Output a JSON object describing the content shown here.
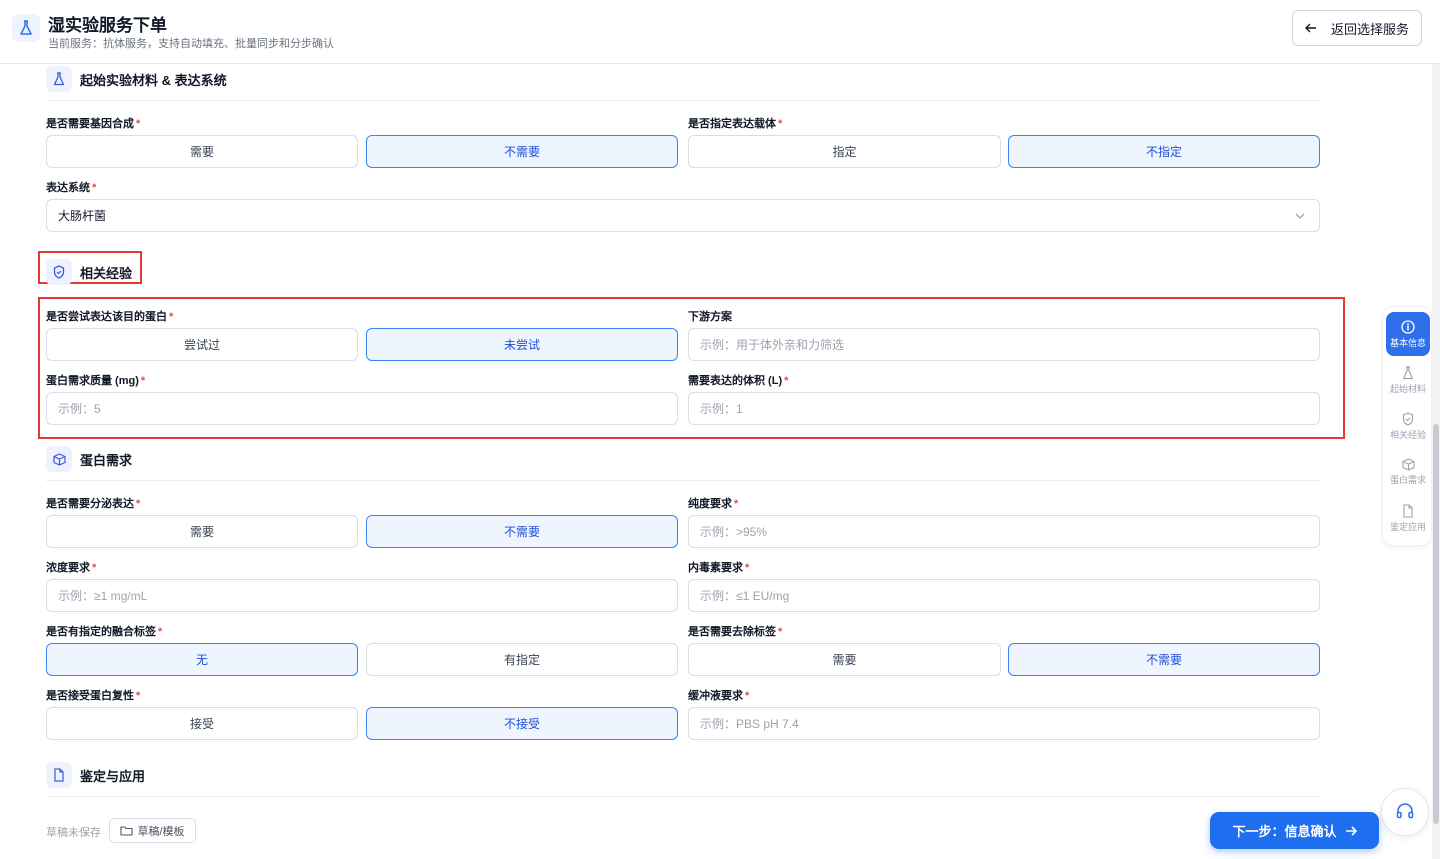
{
  "header": {
    "title": "湿实验服务下单",
    "subtitle": "当前服务：抗体服务，支持自动填充、批量同步和分步确认",
    "back_label": "返回选择服务"
  },
  "sections": {
    "material": {
      "title": "起始实验材料 & 表达系统",
      "gene_synthesis": {
        "label": "是否需要基因合成",
        "options": [
          "需要",
          "不需要"
        ],
        "selected": "不需要"
      },
      "vector": {
        "label": "是否指定表达载体",
        "options": [
          "指定",
          "不指定"
        ],
        "selected": "不指定"
      },
      "expression_system": {
        "label": "表达系统",
        "value": "大肠杆菌"
      }
    },
    "experience": {
      "title": "相关经验",
      "tried": {
        "label": "是否尝试表达该目的蛋白",
        "options": [
          "尝试过",
          "未尝试"
        ],
        "selected": "未尝试"
      },
      "downstream": {
        "label": "下游方案",
        "placeholder": "示例：用于体外亲和力筛选"
      },
      "protein_mass": {
        "label": "蛋白需求质量 (mg)",
        "placeholder": "示例：5"
      },
      "volume": {
        "label": "需要表达的体积 (L)",
        "placeholder": "示例：1"
      }
    },
    "protein": {
      "title": "蛋白需求",
      "secretion": {
        "label": "是否需要分泌表达",
        "options": [
          "需要",
          "不需要"
        ],
        "selected": "不需要"
      },
      "purity": {
        "label": "纯度要求",
        "placeholder": "示例：>95%"
      },
      "concentration": {
        "label": "浓度要求",
        "placeholder": "示例：≥1 mg/mL"
      },
      "endotoxin": {
        "label": "内毒素要求",
        "placeholder": "示例：≤1 EU/mg"
      },
      "fusion_tag": {
        "label": "是否有指定的融合标签",
        "options": [
          "无",
          "有指定"
        ],
        "selected": "无"
      },
      "tag_removal": {
        "label": "是否需要去除标签",
        "options": [
          "需要",
          "不需要"
        ],
        "selected": "不需要"
      },
      "refolding": {
        "label": "是否接受蛋白复性",
        "options": [
          "接受",
          "不接受"
        ],
        "selected": "不接受"
      },
      "buffer": {
        "label": "缓冲液要求",
        "placeholder": "示例：PBS pH 7.4"
      }
    },
    "identification": {
      "title": "鉴定与应用"
    }
  },
  "anchor_nav": [
    {
      "label": "基本信息",
      "icon": "info-icon",
      "active": true
    },
    {
      "label": "起始材料",
      "icon": "flask-icon",
      "active": false
    },
    {
      "label": "相关经验",
      "icon": "shield-icon",
      "active": false
    },
    {
      "label": "蛋白需求",
      "icon": "cube-icon",
      "active": false
    },
    {
      "label": "鉴定应用",
      "icon": "file-icon",
      "active": false
    }
  ],
  "footer": {
    "draft_status": "草稿未保存",
    "draft_button": "草稿/模板",
    "next_button": "下一步：信息确认"
  },
  "colors": {
    "accent": "#1e6ff0",
    "selected_bg": "#eef5ff",
    "selected_border": "#3b82f6",
    "required": "#ef4444",
    "highlight_box": "#e53935"
  }
}
